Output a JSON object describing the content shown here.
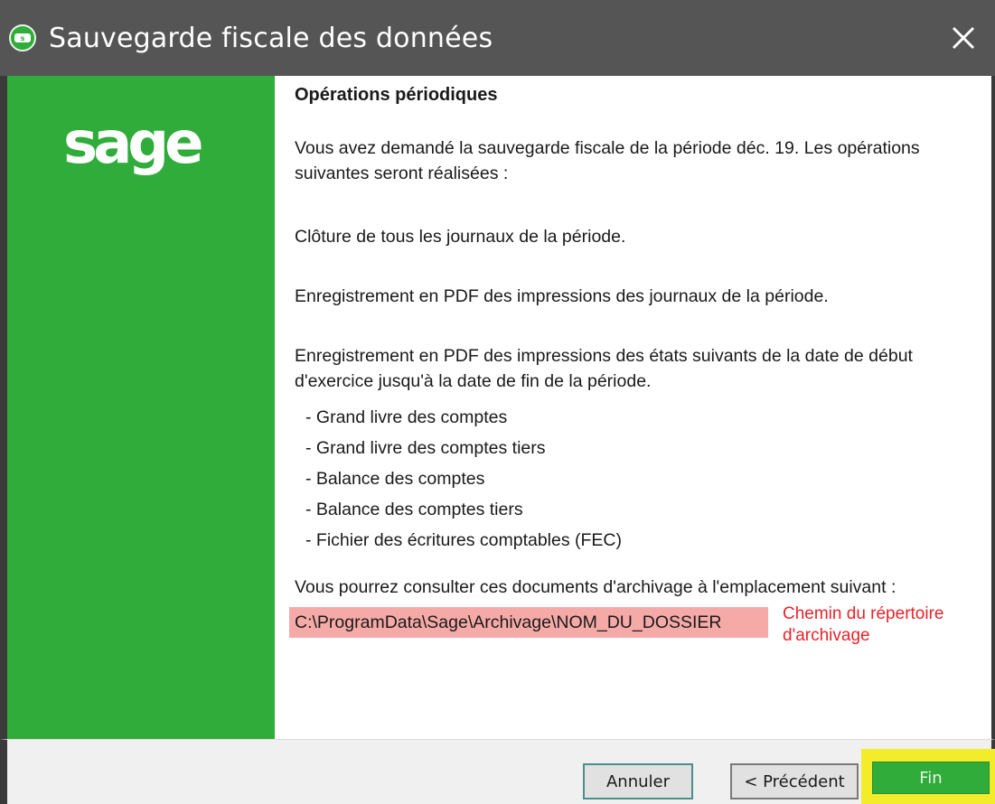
{
  "window": {
    "title": "Sauvegarde fiscale des données",
    "close_glyph": "✕"
  },
  "sidebar": {
    "logo": "sage",
    "accent": "#2fac3a"
  },
  "content": {
    "title": "Opérations périodiques",
    "intro_line1": "Vous avez demandé la sauvegarde fiscale de la période déc. 19. Les opérations",
    "intro_line2": "suivantes seront réalisées :",
    "op1": "Clôture de tous les journaux de la période.",
    "op2": "Enregistrement en PDF des impressions des journaux de la période.",
    "op3_line1": "Enregistrement en PDF des impressions des états suivants de la date de début",
    "op3_line2": "d'exercice jusqu'à la date de fin de la période.",
    "bullets": [
      "- Grand livre des comptes",
      "- Grand livre des comptes tiers",
      "- Balance des comptes",
      "- Balance des comptes tiers",
      "- Fichier des écritures comptables (FEC)"
    ],
    "location_label": "Vous pourrez consulter ces documents d'archivage à l'emplacement suivant :",
    "path": "C:\\ProgramData\\Sage\\Archivage\\NOM_DU_DOSSIER",
    "annotation_line1": "Chemin du répertoire",
    "annotation_line2": "d'archivage"
  },
  "footer": {
    "cancel_label": "Annuler",
    "prev_label": "< Précédent",
    "finish_label": "Fin"
  },
  "colors": {
    "titlebar": "#555555",
    "brand_green": "#2fac3a",
    "path_highlight": "#f5aaa8",
    "annotation_red": "#e8232a",
    "finish_highlight": "#f2ec2a"
  },
  "icons": {
    "app": "sage-app-icon",
    "close": "close-icon"
  }
}
